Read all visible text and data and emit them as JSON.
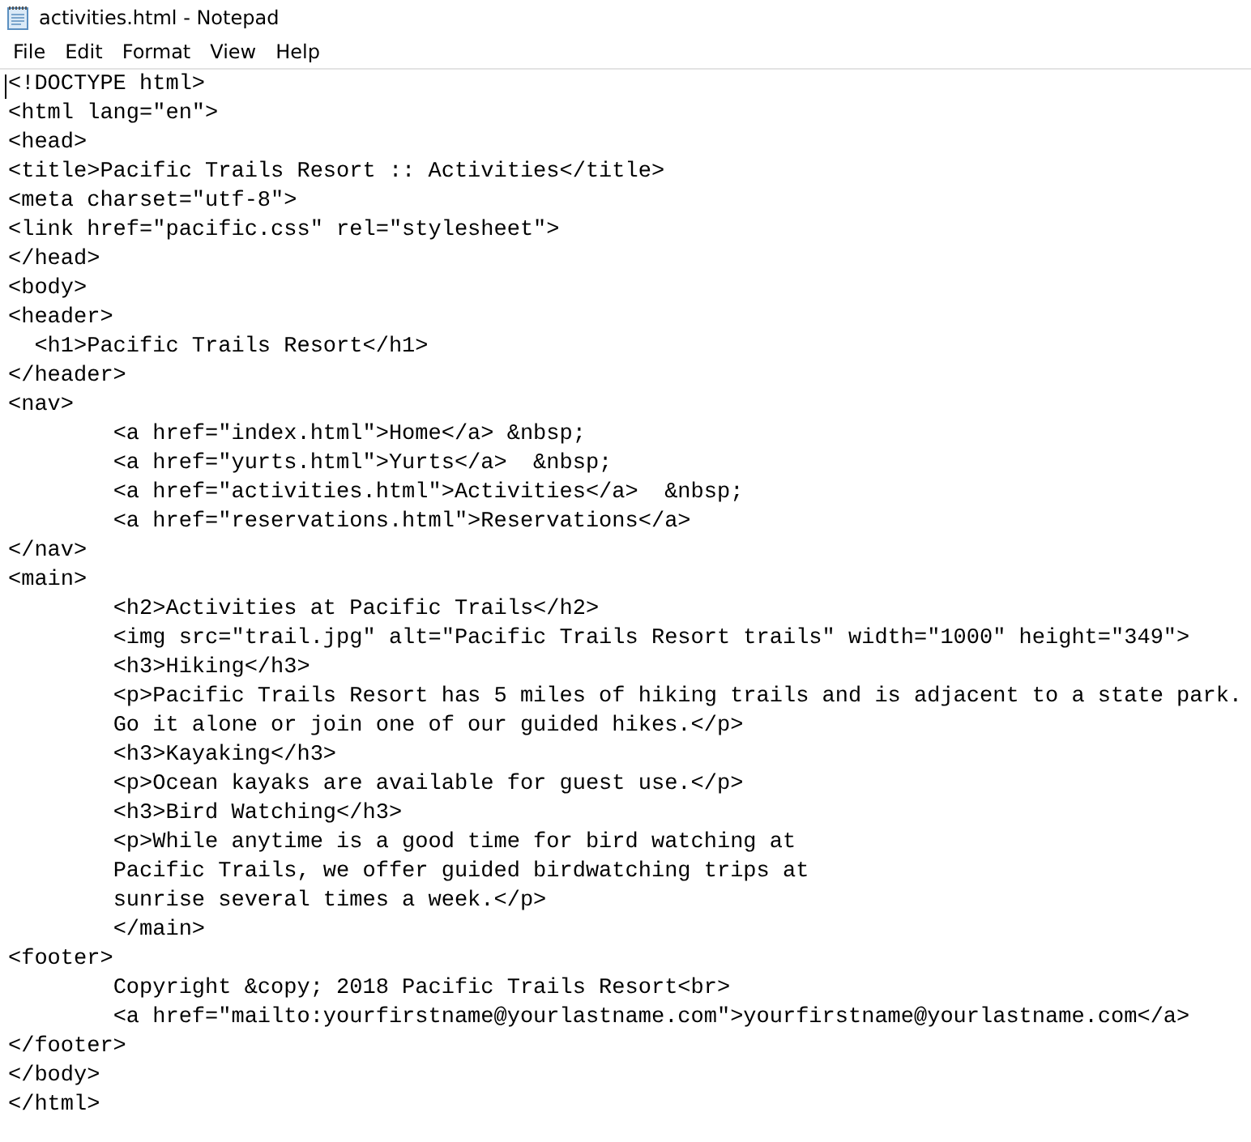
{
  "window": {
    "title": "activities.html - Notepad"
  },
  "menu": [
    "File",
    "Edit",
    "Format",
    "View",
    "Help"
  ],
  "lines": [
    "<!DOCTYPE html>",
    "<html lang=\"en\">",
    "<head>",
    "<title>Pacific Trails Resort :: Activities</title>",
    "<meta charset=\"utf-8\">",
    "<link href=\"pacific.css\" rel=\"stylesheet\">",
    "</head>",
    "<body>",
    "<header>",
    "  <h1>Pacific Trails Resort</h1>",
    "</header>",
    "<nav>",
    "\t<a href=\"index.html\">Home</a> &nbsp;",
    "\t<a href=\"yurts.html\">Yurts</a>  &nbsp;",
    "\t<a href=\"activities.html\">Activities</a>  &nbsp;",
    "\t<a href=\"reservations.html\">Reservations</a>",
    "</nav>",
    "<main>",
    "\t<h2>Activities at Pacific Trails</h2>",
    "\t<img src=\"trail.jpg\" alt=\"Pacific Trails Resort trails\" width=\"1000\" height=\"349\">",
    "\t<h3>Hiking</h3>",
    "\t<p>Pacific Trails Resort has 5 miles of hiking trails and is adjacent to a state park.",
    "\tGo it alone or join one of our guided hikes.</p>",
    "\t<h3>Kayaking</h3>",
    "\t<p>Ocean kayaks are available for guest use.</p>",
    "\t<h3>Bird Watching</h3>",
    "\t<p>While anytime is a good time for bird watching at",
    "\tPacific Trails, we offer guided birdwatching trips at",
    "\tsunrise several times a week.</p>",
    "\t</main>",
    "<footer>",
    "\tCopyright &copy; 2018 Pacific Trails Resort<br>",
    "\t<a href=\"mailto:yourfirstname@yourlastname.com\">yourfirstname@yourlastname.com</a>",
    "</footer>",
    "</body>",
    "</html>"
  ]
}
